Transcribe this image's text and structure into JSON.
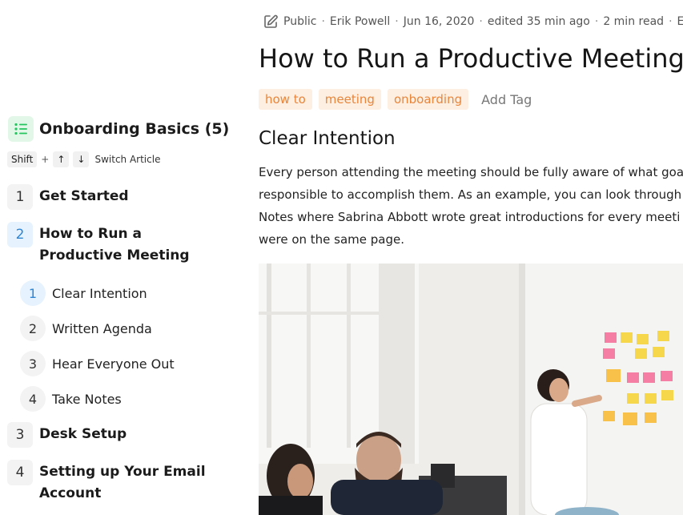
{
  "sidebar": {
    "course_title": "Onboarding Basics (5)",
    "shortcut": {
      "keys": [
        "Shift",
        "+",
        "↑",
        "↓"
      ],
      "label": "Switch Article"
    },
    "items": [
      {
        "num": "1",
        "label": "Get Started"
      },
      {
        "num": "2",
        "label": "How to Run a Productive Meeting"
      },
      {
        "num": "3",
        "label": "Desk Setup"
      },
      {
        "num": "4",
        "label": "Setting up Your Email Account"
      }
    ],
    "subitems": [
      {
        "num": "1",
        "label": "Clear Intention"
      },
      {
        "num": "2",
        "label": "Written Agenda"
      },
      {
        "num": "3",
        "label": "Hear Everyone Out"
      },
      {
        "num": "4",
        "label": "Take Notes"
      }
    ]
  },
  "article": {
    "meta": {
      "visibility": "Public",
      "author": "Erik Powell",
      "date": "Jun 16, 2020",
      "edited": "edited 35 min ago",
      "read_time": "2 min read",
      "language": "EN"
    },
    "title": "How to Run a Productive Meeting",
    "tags": [
      "how to",
      "meeting",
      "onboarding"
    ],
    "add_tag_label": "Add Tag",
    "section_heading": "Clear Intention",
    "paragraph_lines": [
      "Every person attending the meeting should be fully aware of what goa",
      "responsible to accomplish them. As an example, you can look through",
      "Notes where Sabrina Abbott wrote great introductions for every meeti",
      "were on the same page."
    ]
  },
  "colors": {
    "tag_bg": "#fdefe2",
    "tag_text": "#e9853a",
    "active_accent": "#2f86d3",
    "course_icon": "#22c55e"
  },
  "icons": {
    "course": "list-icon",
    "meta": "edit-icon"
  }
}
